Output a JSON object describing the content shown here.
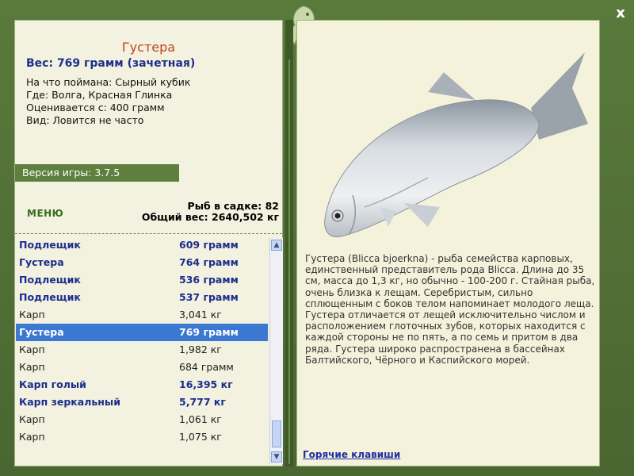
{
  "fish": {
    "title": "Густера",
    "weight": "Вес: 769 грамм (зачетная)",
    "bait": "На что поймана: Сырный кубик",
    "place": "Где: Волга, Красная Глинка",
    "valued_from": "Оценивается с: 400 грамм",
    "kind": "Вид: Ловится не часто"
  },
  "version": "Версия игры: 3.7.5",
  "menu_label": "МЕНЮ",
  "cage": {
    "count": "Рыб в садке: 82",
    "total": "Общий вес: 2640,502 кг"
  },
  "catch_list": [
    {
      "name": "Подлещик",
      "weight": "609 грамм",
      "style": "hl"
    },
    {
      "name": "Густера",
      "weight": "764 грамм",
      "style": "hl"
    },
    {
      "name": "Подлещик",
      "weight": "536 грамм",
      "style": "hl"
    },
    {
      "name": "Подлещик",
      "weight": "537 грамм",
      "style": "hl"
    },
    {
      "name": "Карп",
      "weight": "3,041 кг",
      "style": "plain"
    },
    {
      "name": "Густера",
      "weight": "769 грамм",
      "style": "sel"
    },
    {
      "name": "Карп",
      "weight": "1,982 кг",
      "style": "plain"
    },
    {
      "name": "Карп",
      "weight": "684 грамм",
      "style": "plain"
    },
    {
      "name": "Карп голый",
      "weight": "16,395 кг",
      "style": "hl"
    },
    {
      "name": "Карп зеркальный",
      "weight": "5,777 кг",
      "style": "hl"
    },
    {
      "name": "Карп",
      "weight": "1,061 кг",
      "style": "plain"
    },
    {
      "name": "Карп",
      "weight": "1,075 кг",
      "style": "plain"
    }
  ],
  "description": "Густера (Blicca bjoerkna) - рыба семейства карповых, единственный представитель рода Blicca. Длина до 35 см, масса до 1,3 кг, но обычно - 100-200 г. Стайная рыба, очень близка к лещам. Серебристым, сильно сплющенным с боков телом напоминает молодого леща. Густера отличается от лещей исключительно числом и расположением глоточных зубов, которых находится с каждой стороны не по пять, а по семь и притом в два ряда. Густера широко распространена в бассейнах Балтийского, Чёрного и Каспийского морей.",
  "hotkeys_label": "Горячие клавиши",
  "close_label": "x",
  "colors": {
    "frame": "#4f6d35",
    "panel": "#f3f1df",
    "title": "#c0461b",
    "highlight_text": "#1b2e8c",
    "selection": "#3a78d1"
  },
  "icons": {
    "logo": "fish-logo-icon",
    "close": "close-icon",
    "scroll_up": "chevron-up-icon",
    "scroll_down": "chevron-down-icon"
  }
}
